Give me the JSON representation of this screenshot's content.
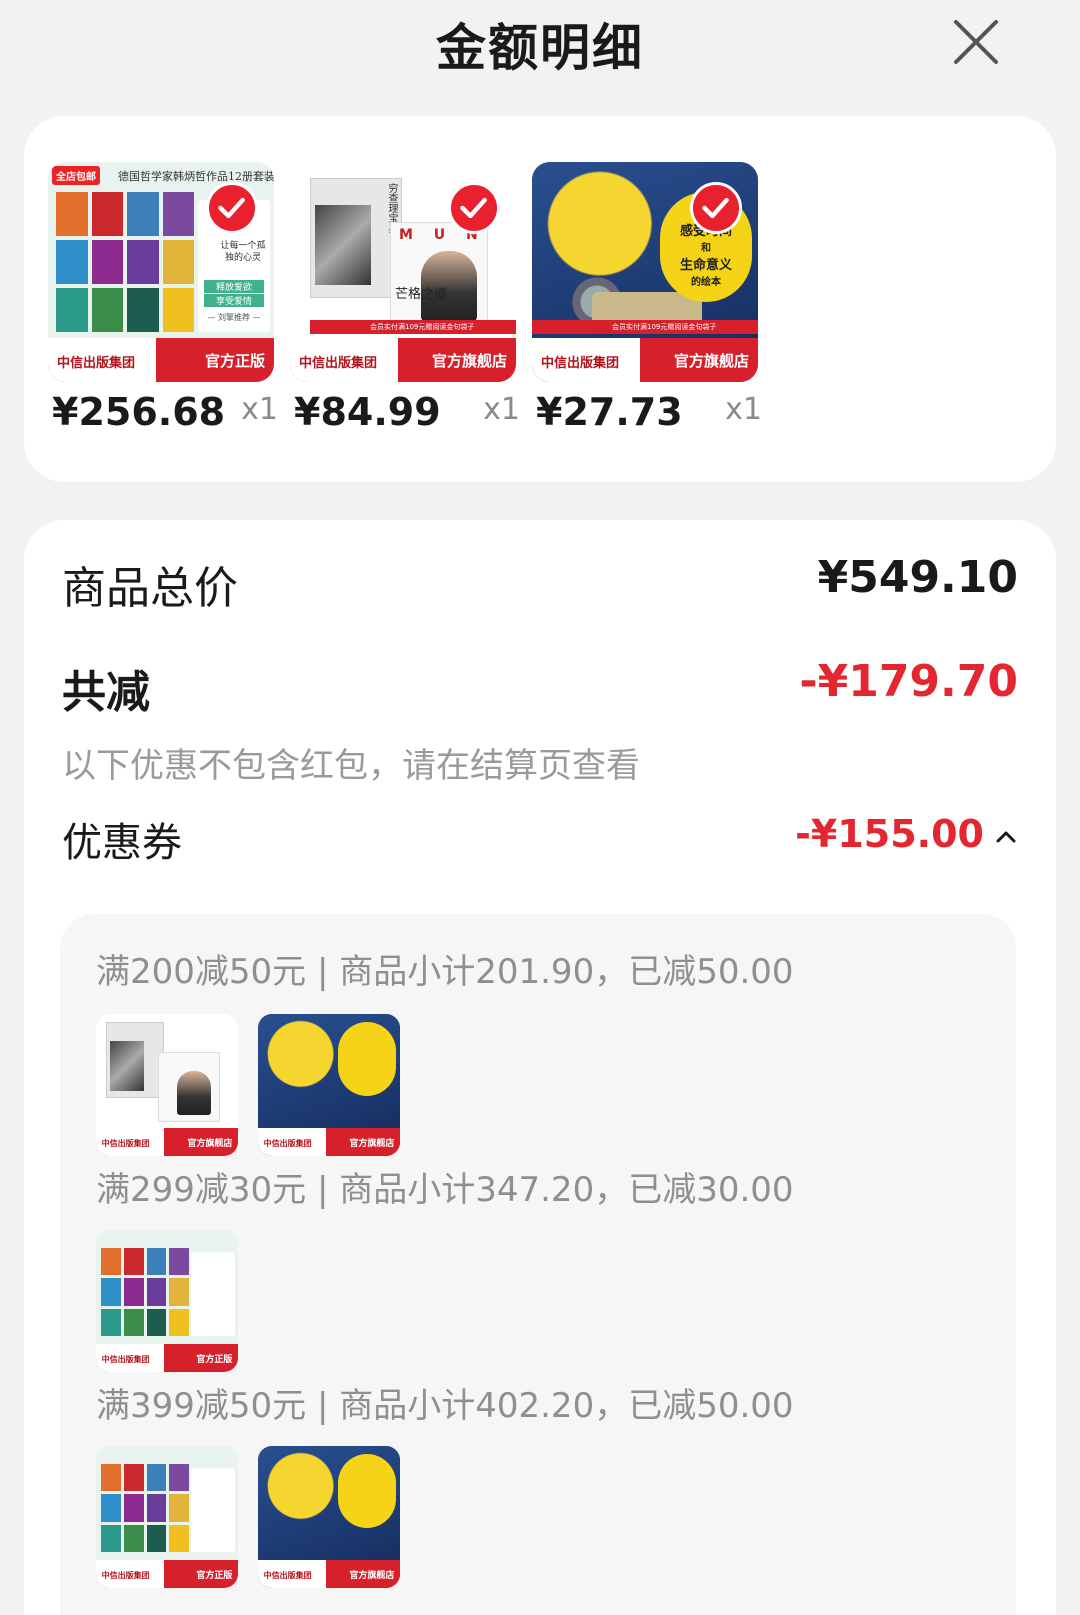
{
  "header": {
    "title": "金额明细",
    "close_icon": "close-icon"
  },
  "products": [
    {
      "cover": "han-byung-chul-12-vol-set",
      "price": "¥256.68",
      "qty": "x1",
      "selected": true,
      "cover_top": "德国哲学家韩炳哲作品12册套装",
      "cover_badge": "全店包邮",
      "cover_quote": "让每一个孤独的心灵",
      "cover_tags": [
        "释放爱欲",
        "享受爱情"
      ],
      "cover_recommend": "— 刘擎推荐 —",
      "publisher": "中信出版集团",
      "shop_tag": "官方正版"
    },
    {
      "cover": "munger-way",
      "price": "¥84.99",
      "qty": "x1",
      "selected": true,
      "cover_top": "穷查理宝典",
      "cover_title": "芒格之道",
      "cover_letters": "M U N",
      "cover_promo": "会员实付满109元赠阅读金句袋子",
      "publisher": "中信出版集团",
      "shop_tag": "官方旗舰店"
    },
    {
      "cover": "time-picture-book",
      "price": "¥27.73",
      "qty": "x1",
      "selected": true,
      "cover_bubble": [
        "感受时间",
        "和",
        "生命意义",
        "的绘本"
      ],
      "cover_promo": "会员实付满109元赠阅读金句袋子",
      "publisher": "中信出版集团",
      "shop_tag": "官方旗舰店"
    }
  ],
  "summary": {
    "total_label": "商品总价",
    "total_value": "¥549.10",
    "reduce_label": "共减",
    "reduce_value": "-¥179.70",
    "note": "以下优惠不包含红包，请在结算页查看",
    "coupon_label": "优惠券",
    "coupon_value": "-¥155.00",
    "coupon_toggle_icon": "chevron-up-icon"
  },
  "coupon_rules": [
    {
      "text": "满200减50元 | 商品小计201.90，已减50.00",
      "items": [
        "munger-way",
        "time-picture-book"
      ]
    },
    {
      "text": "满299减30元 | 商品小计347.20，已减30.00",
      "items": [
        "han-byung-chul-12-vol-set"
      ]
    },
    {
      "text": "满399减50元 | 商品小计402.20，已减50.00",
      "items": [
        "han-byung-chul-12-vol-set",
        "time-picture-book"
      ]
    }
  ],
  "colors": {
    "accent_red": "#e9202e",
    "discount_red": "#e3262f",
    "muted_text": "#9a9a9a",
    "page_bg": "#f2f2f2"
  }
}
